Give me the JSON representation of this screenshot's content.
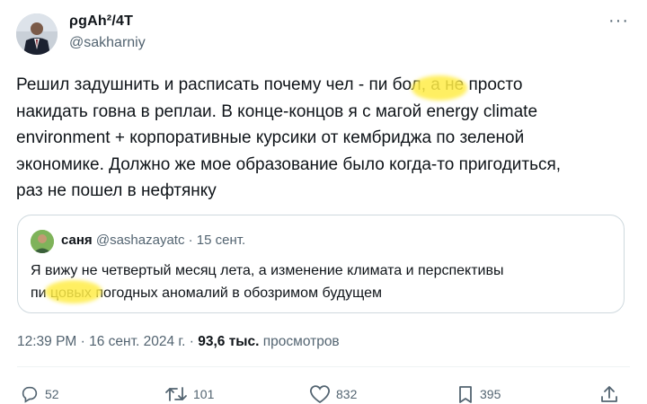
{
  "author": {
    "display_name": "ρgAh²/4T",
    "handle": "@sakharniy"
  },
  "tweet": {
    "lines": [
      "Решил задушнить и  расписать почему чел - пи      бол, а не просто",
      "накидать говна в реплаи. В конце-концов я с магой energy climate",
      "environment + корпоративные курсики от кембриджа по зеленой",
      "экономике. Должно же мое образование было когда-то пригодиться,",
      "раз не пошел в нефтянку"
    ]
  },
  "quote": {
    "name": "саня",
    "meta": "@sashazayatc · 15 сент.",
    "lines": [
      "Я вижу не четвертый месяц лета, а изменение климата и перспективы",
      "пи      цовых погодных аномалий в обозримом будущем"
    ]
  },
  "timestamp": {
    "time_date": "12:39 PM · 16 сент. 2024 г. · ",
    "views_count": "93,6 тыс.",
    "views_label": " просмотров"
  },
  "actions": {
    "replies": "52",
    "reposts": "101",
    "likes": "832",
    "bookmarks": "395"
  },
  "icons": {
    "more": "more-icon",
    "reply": "reply-icon",
    "repost": "repost-icon",
    "like": "heart-icon",
    "bookmark": "bookmark-icon",
    "share": "share-icon"
  },
  "colors": {
    "text": "#0f1419",
    "secondary": "#536471",
    "border": "#cfd9de",
    "redaction": "#ffec46"
  }
}
